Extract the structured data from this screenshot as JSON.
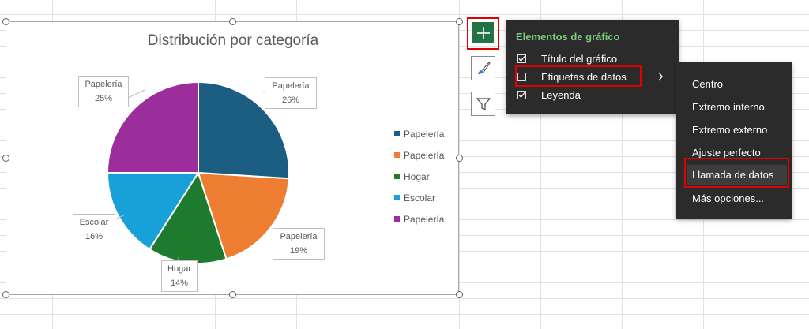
{
  "chart_data": {
    "type": "pie",
    "title": "Distribución por categoría",
    "slices": [
      {
        "label": "Papelería",
        "value": 26,
        "color": "#1b5e82"
      },
      {
        "label": "Papelería",
        "value": 19,
        "color": "#ed7d31"
      },
      {
        "label": "Hogar",
        "value": 14,
        "color": "#1e7a2e"
      },
      {
        "label": "Escolar",
        "value": 16,
        "color": "#18a0d8"
      },
      {
        "label": "Papelería",
        "value": 25,
        "color": "#9b2e9b"
      }
    ],
    "legend": [
      "Papelería",
      "Papelería",
      "Hogar",
      "Escolar",
      "Papelería"
    ],
    "legend_position": "right",
    "data_labels": [
      {
        "category": "Papelería",
        "percent": "26%"
      },
      {
        "category": "Papelería",
        "percent": "19%"
      },
      {
        "category": "Hogar",
        "percent": "14%"
      },
      {
        "category": "Escolar",
        "percent": "16%"
      },
      {
        "category": "Papelería",
        "percent": "25%"
      }
    ]
  },
  "side_buttons": {
    "elements_icon": "plus-icon",
    "styles_icon": "brush-icon",
    "filters_icon": "funnel-icon"
  },
  "elements_menu": {
    "title": "Elementos de gráfico",
    "items": [
      {
        "label": "Título del gráfico",
        "checked": true
      },
      {
        "label": "Etiquetas de datos",
        "checked": false
      },
      {
        "label": "Leyenda",
        "checked": true
      }
    ]
  },
  "label_submenu": {
    "items": [
      "Centro",
      "Extremo interno",
      "Extremo externo",
      "Ajuste perfecto",
      "Llamada de datos",
      "Más opciones..."
    ]
  },
  "colors": {
    "accent": "#217346",
    "highlight": "#e00000",
    "menu_bg": "#2b2b2b"
  }
}
